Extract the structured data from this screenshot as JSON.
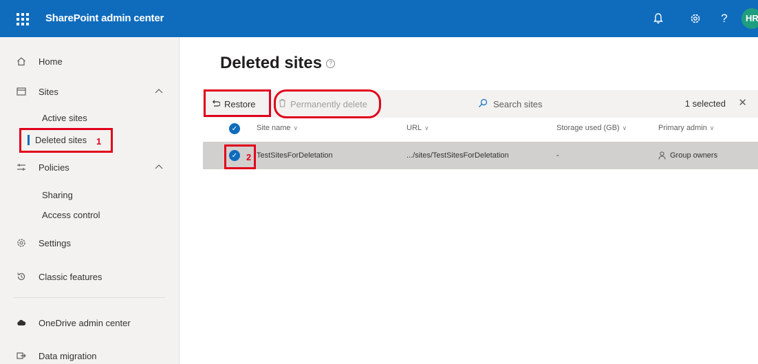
{
  "suitebar": {
    "app_title": "SharePoint admin center",
    "avatar_initials": "HR"
  },
  "nav": {
    "home": "Home",
    "sites": "Sites",
    "active_sites": "Active sites",
    "deleted_sites": "Deleted sites",
    "policies": "Policies",
    "sharing": "Sharing",
    "access_control": "Access control",
    "settings": "Settings",
    "classic_features": "Classic features",
    "onedrive_admin_center": "OneDrive admin center",
    "data_migration": "Data migration"
  },
  "main": {
    "title": "Deleted sites",
    "toolbar": {
      "restore": "Restore",
      "permanently_delete": "Permanently delete",
      "search_placeholder": "Search sites",
      "selected_count": "1 selected"
    },
    "table": {
      "columns": [
        "Site name",
        "URL",
        "Storage used (GB)",
        "Primary admin"
      ],
      "rows": [
        {
          "site_name": "TestSitesForDeletation",
          "url": ".../sites/TestSitesForDeletation",
          "storage": "-",
          "primary_admin": "Group owners"
        }
      ]
    }
  },
  "annotations": {
    "step1": "1",
    "step2": "2"
  },
  "colors": {
    "brand": "#0f6cbd",
    "annotation_red": "#e0001b",
    "selected_row": "#d2d0ce"
  }
}
